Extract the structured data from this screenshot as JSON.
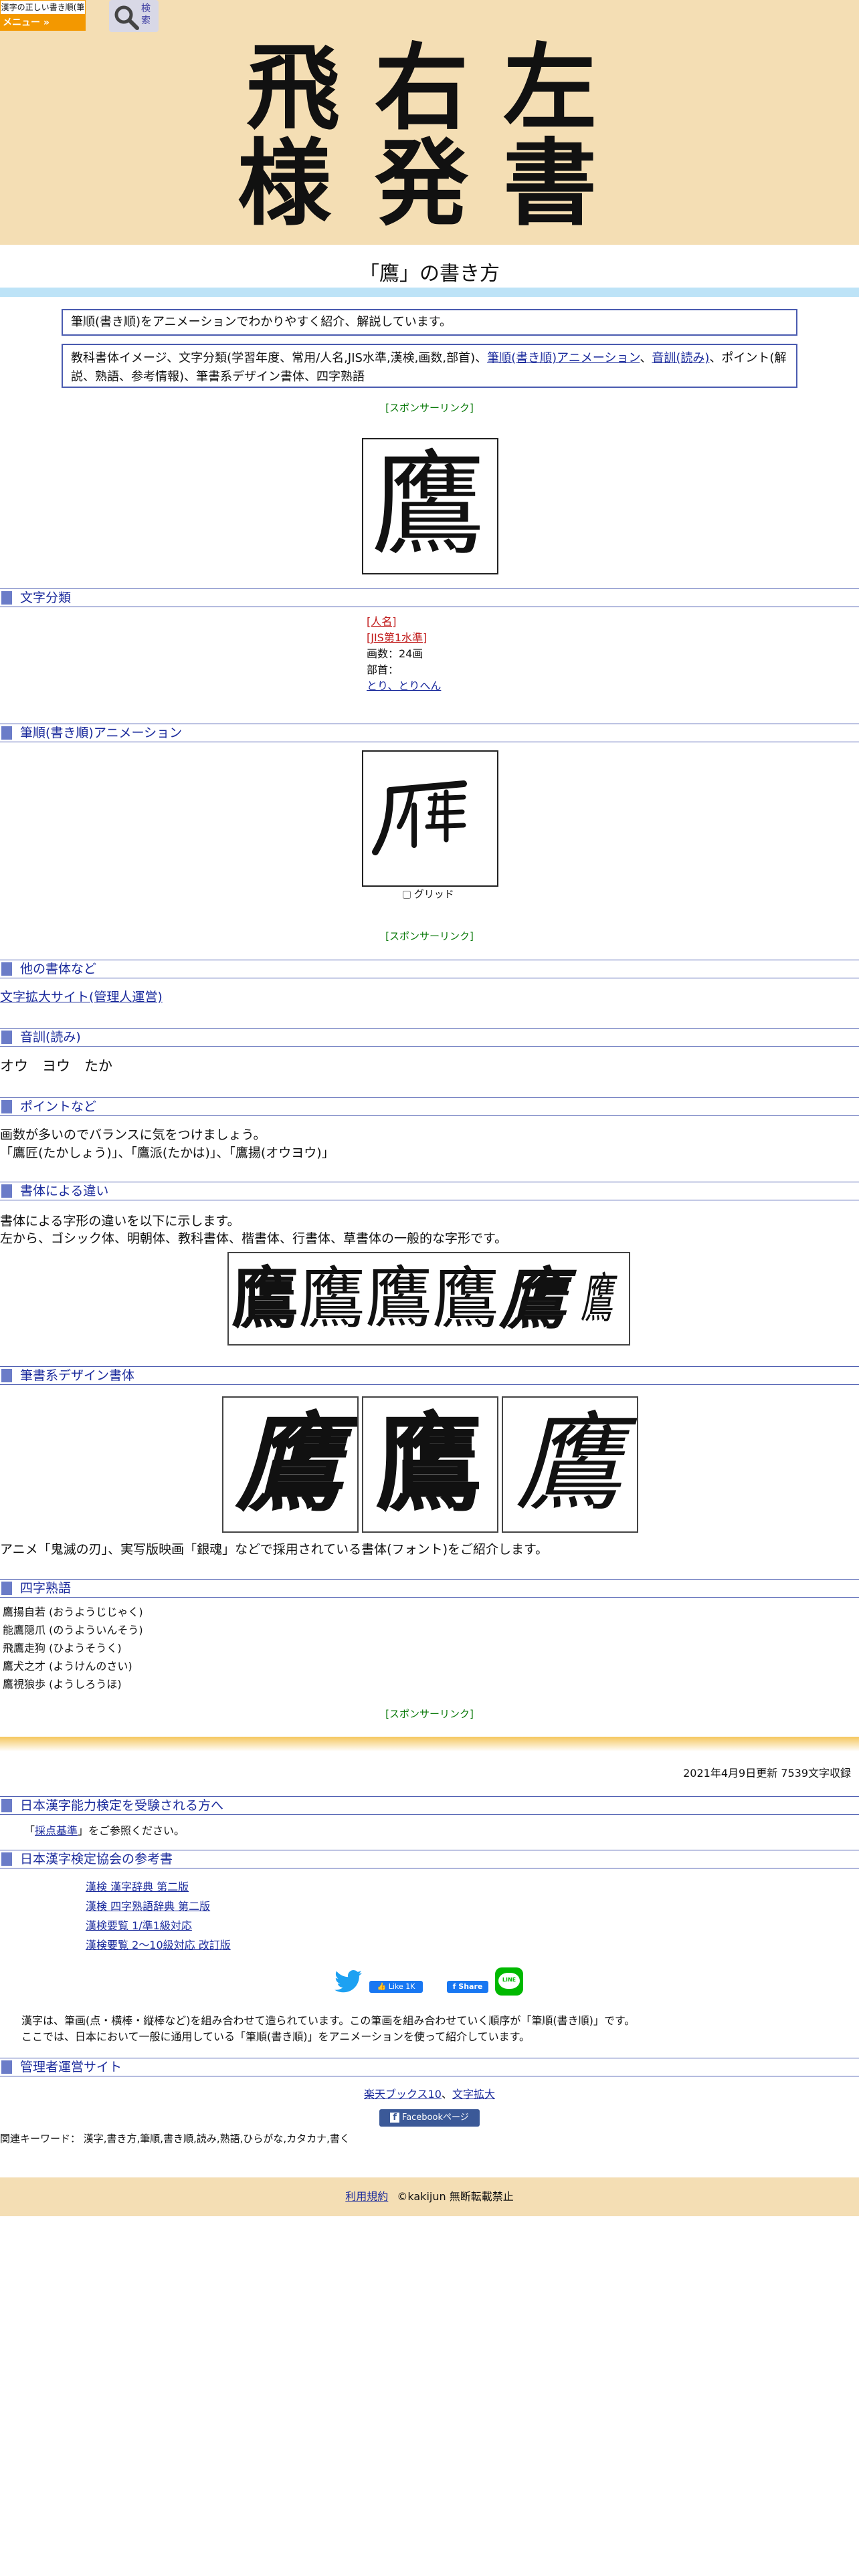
{
  "header": {
    "brand": "漢字の正しい書き順(筆順)",
    "menu_label": "メニュー »",
    "search_label": "検索",
    "hero_chars": [
      "飛",
      "右",
      "左",
      "様",
      "発",
      "書"
    ]
  },
  "page_title": "「鷹」の書き方",
  "intro": {
    "line1": "筆順(書き順)をアニメーションでわかりやすく紹介、解説しています。",
    "line2a": "教科書体イメージ、文字分類(学習年度、常用/人名,JIS水準,漢検,画数,部首)、",
    "line2_link1": "筆順(書き順)アニメーション",
    "line2b": "、",
    "line2_link2": "音訓(読み)",
    "line2c": "、ポイント(解説、熟語、参考情報)、筆書系デザイン書体、四字熟語"
  },
  "sponsor_label": "[スポンサーリンク]",
  "kanji": "鷹",
  "sections": {
    "classification": "文字分類",
    "animation": "筆順(書き順)アニメーション",
    "other_fonts": "他の書体など",
    "reading": "音訓(読み)",
    "points": "ポイントなど",
    "font_diff": "書体による違い",
    "brush_fonts": "筆書系デザイン書体",
    "yoji": "四字熟語",
    "kentei": "日本漢字能力検定を受験される方へ",
    "kentei_books": "日本漢字検定協会の参考書",
    "admin": "管理者運営サイト"
  },
  "classification": {
    "tag1": "[人名]",
    "tag2": "[JIS第1水準]",
    "strokes": "画数：24画",
    "radical_label": "部首：",
    "radical_link": "とり、とりへん"
  },
  "animation": {
    "grid_label": "グリッド"
  },
  "other_fonts": {
    "link": "文字拡大サイト(管理人運営)"
  },
  "reading": {
    "text": "オウ　ヨウ　たか"
  },
  "points": {
    "line1": "画数が多いのでバランスに気をつけましょう。",
    "line2": "「鷹匠(たかしょう)」、「鷹派(たかは)」、「鷹揚(オウヨウ)」"
  },
  "font_diff": {
    "line1": "書体による字形の違いを以下に示します。",
    "line2": "左から、ゴシック体、明朝体、教科書体、楷書体、行書体、草書体の一般的な字形です。"
  },
  "brush_fonts": {
    "caption": "アニメ「鬼滅の刃」、実写版映画「銀魂」などで採用されている書体(フォント)をご紹介します。"
  },
  "yoji": [
    "鷹揚自若 (おうようじじゃく)",
    "能鷹隠爪 (のうよういんそう)",
    "飛鷹走狗 (ひようそうく)",
    "鷹犬之才 (ようけんのさい)",
    "鷹視狼歩 (ようしろうほ)"
  ],
  "updated": "2021年4月9日更新 7539文字収録",
  "kentei": {
    "pre": "「",
    "link": "採点基準",
    "post": "」をご参照ください。"
  },
  "books": [
    "漢検 漢字辞典 第二版",
    "漢検 四字熟語辞典 第二版",
    "漢検要覧 1/準1級対応",
    "漢検要覧 2～10級対応 改訂版"
  ],
  "social": {
    "like": "Like 1K",
    "share": "Share",
    "line": "LINE"
  },
  "about": {
    "line1": "漢字は、筆画(点・横棒・縦棒など)を組み合わせて造られています。この筆画を組み合わせていく順序が「筆順(書き順)」です。",
    "line2": "ここでは、日本において一般に通用している「筆順(書き順)」をアニメーションを使って紹介しています。"
  },
  "admin": {
    "link1": "楽天ブックス10",
    "sep": "、",
    "link2": "文字拡大",
    "facebook": "Facebookページ"
  },
  "keywords": "関連キーワード： 漢字,書き方,筆順,書き順,読み,熟語,ひらがな,カタカナ,書く",
  "footer": {
    "terms": "利用規約",
    "copyright": "©kakijun 無断転載禁止"
  },
  "colors": {
    "accent_orange": "#f39800",
    "hero_bg": "#f4deb4",
    "section_blue": "#4a5bb0",
    "sponsor_green": "#0a7a0a"
  }
}
